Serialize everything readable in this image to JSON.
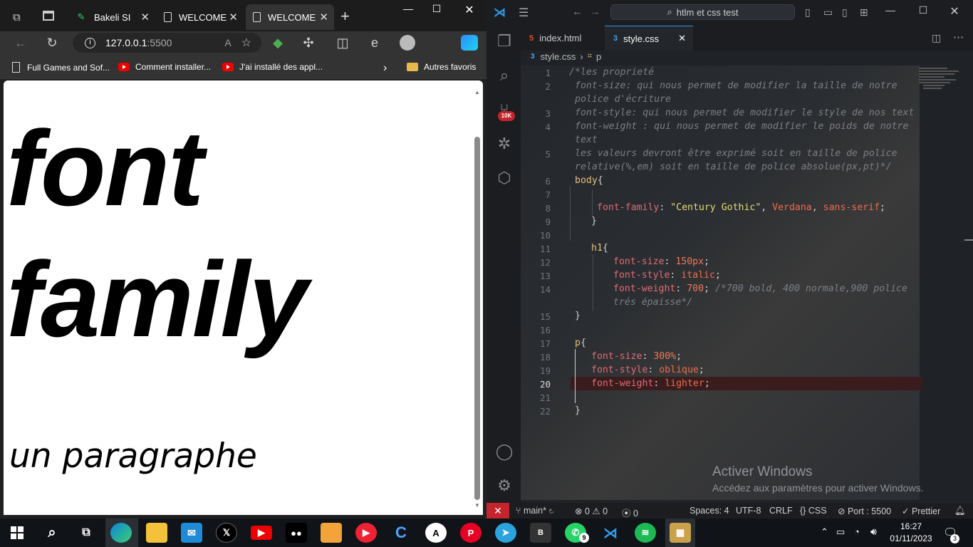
{
  "browser": {
    "tabs": [
      {
        "label": "Bakeli SI"
      },
      {
        "label": "WELCOME"
      },
      {
        "label": "WELCOME"
      }
    ],
    "url": {
      "host": "127.0.0.1",
      "port": ":5500"
    },
    "bookmarks": [
      {
        "label": "Full Games and Sof..."
      },
      {
        "label": "Comment installer..."
      },
      {
        "label": "J'ai installé des appl..."
      }
    ],
    "other_favorites": "Autres favoris",
    "page": {
      "h1_line1": "font",
      "h1_line2": "family",
      "paragraph": "un paragraphe"
    }
  },
  "vscode": {
    "search_placeholder": "htlm et css test",
    "tabs": [
      {
        "label": "index.html"
      },
      {
        "label": "style.css"
      }
    ],
    "breadcrumb": {
      "file": "style.css",
      "symbol": "p"
    },
    "badge": "10K",
    "line_numbers": [
      "1",
      "2",
      "3",
      "4",
      "5",
      "6",
      "7",
      "8",
      "9",
      "10",
      "11",
      "12",
      "13",
      "14",
      "15",
      "16",
      "17",
      "18",
      "19",
      "20",
      "21",
      "22"
    ],
    "code": {
      "c1": "/*les proprieté",
      "c2a": "font-size: qui nous permet de modifier la taille de notre",
      "c2b": "police d'écriture",
      "c3": "font-style: qui nous permet de modifier le style de nos text",
      "c4a": "font-weight : qui nous permet de modifier le poids de notre",
      "c4b": "text",
      "c5a": "les valeurs devront être exprimé soit en taille de police",
      "c5b": "relative(%,em) soit en taille de police absolue(px,pt)*/",
      "body": "body",
      "brace_open": "{",
      "brace_close": "}",
      "ff_prop": "font-family",
      "ff_str": "\"Century Gothic\"",
      "ff_v1": "Verdana",
      "ff_v2": "sans-serif",
      "h1": "h1",
      "fs_prop": "font-size",
      "fs_val": "150px",
      "fst_prop": "font-style",
      "fst_val": "italic",
      "fw_prop": "font-weight",
      "fw_val": "700",
      "fw_cmt_a": "/*700 bold, 400 normale,900 police",
      "fw_cmt_b": "trés épaisse*/",
      "p": "p",
      "p_fs_val": "300%",
      "p_fst_val": "oblique",
      "p_fw_val": "lighter"
    },
    "activate_title": "Activer Windows",
    "activate_sub": "Accédez aux paramètres pour activer Windows.",
    "status": {
      "branch": "main*",
      "errors": "0",
      "warnings": "0",
      "ports": "0",
      "spaces": "Spaces: 4",
      "encoding": "UTF-8",
      "eol": "CRLF",
      "language": "CSS",
      "port": "Port : 5500",
      "prettier": "Prettier"
    }
  },
  "taskbar": {
    "clock_time": "16:27",
    "clock_date": "01/11/2023",
    "notif_count": "3",
    "whatsapp_count": "9",
    "app_b": "B"
  }
}
